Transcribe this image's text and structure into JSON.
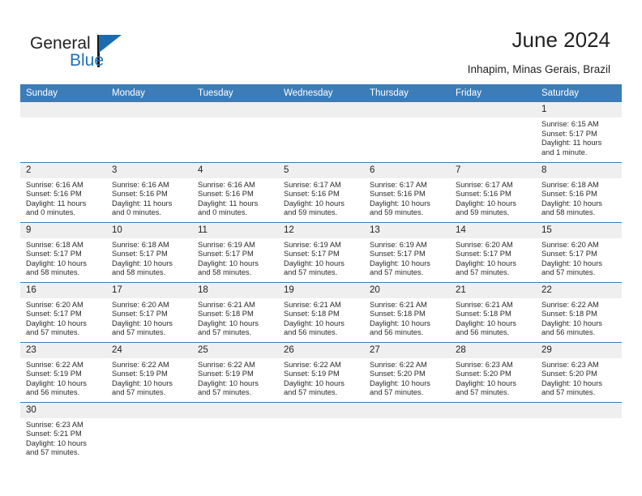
{
  "brand": {
    "name_part1": "General",
    "name_part2": "Blue",
    "logo_icon": "triangle-flag-icon",
    "accent_color": "#1a6cb2"
  },
  "header": {
    "title": "June 2024",
    "location": "Inhapim, Minas Gerais, Brazil"
  },
  "calendar": {
    "header_bg": "#3c7cb8",
    "daynum_bg": "#efefef",
    "weekdays": [
      "Sunday",
      "Monday",
      "Tuesday",
      "Wednesday",
      "Thursday",
      "Friday",
      "Saturday"
    ],
    "weeks": [
      [
        {
          "day": "",
          "sunrise": "",
          "sunset": "",
          "daylight1": "",
          "daylight2": "",
          "empty": true
        },
        {
          "day": "",
          "sunrise": "",
          "sunset": "",
          "daylight1": "",
          "daylight2": "",
          "empty": true
        },
        {
          "day": "",
          "sunrise": "",
          "sunset": "",
          "daylight1": "",
          "daylight2": "",
          "empty": true
        },
        {
          "day": "",
          "sunrise": "",
          "sunset": "",
          "daylight1": "",
          "daylight2": "",
          "empty": true
        },
        {
          "day": "",
          "sunrise": "",
          "sunset": "",
          "daylight1": "",
          "daylight2": "",
          "empty": true
        },
        {
          "day": "",
          "sunrise": "",
          "sunset": "",
          "daylight1": "",
          "daylight2": "",
          "empty": true
        },
        {
          "day": "1",
          "sunrise": "Sunrise: 6:15 AM",
          "sunset": "Sunset: 5:17 PM",
          "daylight1": "Daylight: 11 hours",
          "daylight2": "and 1 minute.",
          "empty": false
        }
      ],
      [
        {
          "day": "2",
          "sunrise": "Sunrise: 6:16 AM",
          "sunset": "Sunset: 5:16 PM",
          "daylight1": "Daylight: 11 hours",
          "daylight2": "and 0 minutes.",
          "empty": false
        },
        {
          "day": "3",
          "sunrise": "Sunrise: 6:16 AM",
          "sunset": "Sunset: 5:16 PM",
          "daylight1": "Daylight: 11 hours",
          "daylight2": "and 0 minutes.",
          "empty": false
        },
        {
          "day": "4",
          "sunrise": "Sunrise: 6:16 AM",
          "sunset": "Sunset: 5:16 PM",
          "daylight1": "Daylight: 11 hours",
          "daylight2": "and 0 minutes.",
          "empty": false
        },
        {
          "day": "5",
          "sunrise": "Sunrise: 6:17 AM",
          "sunset": "Sunset: 5:16 PM",
          "daylight1": "Daylight: 10 hours",
          "daylight2": "and 59 minutes.",
          "empty": false
        },
        {
          "day": "6",
          "sunrise": "Sunrise: 6:17 AM",
          "sunset": "Sunset: 5:16 PM",
          "daylight1": "Daylight: 10 hours",
          "daylight2": "and 59 minutes.",
          "empty": false
        },
        {
          "day": "7",
          "sunrise": "Sunrise: 6:17 AM",
          "sunset": "Sunset: 5:16 PM",
          "daylight1": "Daylight: 10 hours",
          "daylight2": "and 59 minutes.",
          "empty": false
        },
        {
          "day": "8",
          "sunrise": "Sunrise: 6:18 AM",
          "sunset": "Sunset: 5:16 PM",
          "daylight1": "Daylight: 10 hours",
          "daylight2": "and 58 minutes.",
          "empty": false
        }
      ],
      [
        {
          "day": "9",
          "sunrise": "Sunrise: 6:18 AM",
          "sunset": "Sunset: 5:17 PM",
          "daylight1": "Daylight: 10 hours",
          "daylight2": "and 58 minutes.",
          "empty": false
        },
        {
          "day": "10",
          "sunrise": "Sunrise: 6:18 AM",
          "sunset": "Sunset: 5:17 PM",
          "daylight1": "Daylight: 10 hours",
          "daylight2": "and 58 minutes.",
          "empty": false
        },
        {
          "day": "11",
          "sunrise": "Sunrise: 6:19 AM",
          "sunset": "Sunset: 5:17 PM",
          "daylight1": "Daylight: 10 hours",
          "daylight2": "and 58 minutes.",
          "empty": false
        },
        {
          "day": "12",
          "sunrise": "Sunrise: 6:19 AM",
          "sunset": "Sunset: 5:17 PM",
          "daylight1": "Daylight: 10 hours",
          "daylight2": "and 57 minutes.",
          "empty": false
        },
        {
          "day": "13",
          "sunrise": "Sunrise: 6:19 AM",
          "sunset": "Sunset: 5:17 PM",
          "daylight1": "Daylight: 10 hours",
          "daylight2": "and 57 minutes.",
          "empty": false
        },
        {
          "day": "14",
          "sunrise": "Sunrise: 6:20 AM",
          "sunset": "Sunset: 5:17 PM",
          "daylight1": "Daylight: 10 hours",
          "daylight2": "and 57 minutes.",
          "empty": false
        },
        {
          "day": "15",
          "sunrise": "Sunrise: 6:20 AM",
          "sunset": "Sunset: 5:17 PM",
          "daylight1": "Daylight: 10 hours",
          "daylight2": "and 57 minutes.",
          "empty": false
        }
      ],
      [
        {
          "day": "16",
          "sunrise": "Sunrise: 6:20 AM",
          "sunset": "Sunset: 5:17 PM",
          "daylight1": "Daylight: 10 hours",
          "daylight2": "and 57 minutes.",
          "empty": false
        },
        {
          "day": "17",
          "sunrise": "Sunrise: 6:20 AM",
          "sunset": "Sunset: 5:17 PM",
          "daylight1": "Daylight: 10 hours",
          "daylight2": "and 57 minutes.",
          "empty": false
        },
        {
          "day": "18",
          "sunrise": "Sunrise: 6:21 AM",
          "sunset": "Sunset: 5:18 PM",
          "daylight1": "Daylight: 10 hours",
          "daylight2": "and 57 minutes.",
          "empty": false
        },
        {
          "day": "19",
          "sunrise": "Sunrise: 6:21 AM",
          "sunset": "Sunset: 5:18 PM",
          "daylight1": "Daylight: 10 hours",
          "daylight2": "and 56 minutes.",
          "empty": false
        },
        {
          "day": "20",
          "sunrise": "Sunrise: 6:21 AM",
          "sunset": "Sunset: 5:18 PM",
          "daylight1": "Daylight: 10 hours",
          "daylight2": "and 56 minutes.",
          "empty": false
        },
        {
          "day": "21",
          "sunrise": "Sunrise: 6:21 AM",
          "sunset": "Sunset: 5:18 PM",
          "daylight1": "Daylight: 10 hours",
          "daylight2": "and 56 minutes.",
          "empty": false
        },
        {
          "day": "22",
          "sunrise": "Sunrise: 6:22 AM",
          "sunset": "Sunset: 5:18 PM",
          "daylight1": "Daylight: 10 hours",
          "daylight2": "and 56 minutes.",
          "empty": false
        }
      ],
      [
        {
          "day": "23",
          "sunrise": "Sunrise: 6:22 AM",
          "sunset": "Sunset: 5:19 PM",
          "daylight1": "Daylight: 10 hours",
          "daylight2": "and 56 minutes.",
          "empty": false
        },
        {
          "day": "24",
          "sunrise": "Sunrise: 6:22 AM",
          "sunset": "Sunset: 5:19 PM",
          "daylight1": "Daylight: 10 hours",
          "daylight2": "and 57 minutes.",
          "empty": false
        },
        {
          "day": "25",
          "sunrise": "Sunrise: 6:22 AM",
          "sunset": "Sunset: 5:19 PM",
          "daylight1": "Daylight: 10 hours",
          "daylight2": "and 57 minutes.",
          "empty": false
        },
        {
          "day": "26",
          "sunrise": "Sunrise: 6:22 AM",
          "sunset": "Sunset: 5:19 PM",
          "daylight1": "Daylight: 10 hours",
          "daylight2": "and 57 minutes.",
          "empty": false
        },
        {
          "day": "27",
          "sunrise": "Sunrise: 6:22 AM",
          "sunset": "Sunset: 5:20 PM",
          "daylight1": "Daylight: 10 hours",
          "daylight2": "and 57 minutes.",
          "empty": false
        },
        {
          "day": "28",
          "sunrise": "Sunrise: 6:23 AM",
          "sunset": "Sunset: 5:20 PM",
          "daylight1": "Daylight: 10 hours",
          "daylight2": "and 57 minutes.",
          "empty": false
        },
        {
          "day": "29",
          "sunrise": "Sunrise: 6:23 AM",
          "sunset": "Sunset: 5:20 PM",
          "daylight1": "Daylight: 10 hours",
          "daylight2": "and 57 minutes.",
          "empty": false
        }
      ],
      [
        {
          "day": "30",
          "sunrise": "Sunrise: 6:23 AM",
          "sunset": "Sunset: 5:21 PM",
          "daylight1": "Daylight: 10 hours",
          "daylight2": "and 57 minutes.",
          "empty": false
        },
        {
          "day": "",
          "sunrise": "",
          "sunset": "",
          "daylight1": "",
          "daylight2": "",
          "empty": true
        },
        {
          "day": "",
          "sunrise": "",
          "sunset": "",
          "daylight1": "",
          "daylight2": "",
          "empty": true
        },
        {
          "day": "",
          "sunrise": "",
          "sunset": "",
          "daylight1": "",
          "daylight2": "",
          "empty": true
        },
        {
          "day": "",
          "sunrise": "",
          "sunset": "",
          "daylight1": "",
          "daylight2": "",
          "empty": true
        },
        {
          "day": "",
          "sunrise": "",
          "sunset": "",
          "daylight1": "",
          "daylight2": "",
          "empty": true
        },
        {
          "day": "",
          "sunrise": "",
          "sunset": "",
          "daylight1": "",
          "daylight2": "",
          "empty": true
        }
      ]
    ]
  }
}
